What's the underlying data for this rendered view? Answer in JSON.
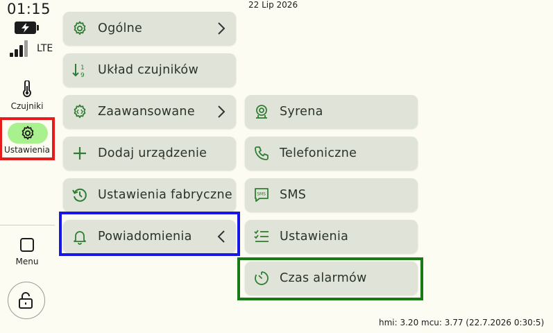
{
  "status": {
    "time": "01:15",
    "network": "LTE",
    "date": "22 Lip 2026",
    "version_info": "hmi: 3.20 mcu: 3.77 (22.7.2026 0:30:5)"
  },
  "sidebar": {
    "items": [
      {
        "label": "Czujniki",
        "icon": "thermometer-icon"
      },
      {
        "label": "Ustawienia",
        "icon": "gear-icon",
        "selected": true
      },
      {
        "label": "Menu",
        "icon": "square-icon"
      }
    ],
    "lock_icon": "unlock-icon"
  },
  "menu": {
    "main": [
      {
        "label": "Ogólne",
        "icon": "gear-icon",
        "chevron": "right"
      },
      {
        "label": "Układ czujników",
        "icon": "sort-icon"
      },
      {
        "label": "Zaawansowane",
        "icon": "gear-code-icon",
        "chevron": "right"
      },
      {
        "label": "Dodaj urządzenie",
        "icon": "plus-icon"
      },
      {
        "label": "Ustawienia fabryczne",
        "icon": "history-icon"
      },
      {
        "label": "Powiadomienia",
        "icon": "bell-icon",
        "chevron": "left"
      }
    ],
    "sub": [
      {
        "label": "Syrena",
        "icon": "siren-icon"
      },
      {
        "label": "Telefoniczne",
        "icon": "phone-icon"
      },
      {
        "label": "SMS",
        "icon": "sms-icon"
      },
      {
        "label": "Ustawienia",
        "icon": "checklist-icon"
      },
      {
        "label": "Czas alarmów",
        "icon": "timer-icon"
      }
    ]
  },
  "colors": {
    "background": "#fcfcf3",
    "button": "#dfe3d8",
    "icon": "#2e7d32",
    "selected_pill": "#a9f08f",
    "highlight_red": "#e81b1b",
    "highlight_blue": "#1717e6",
    "highlight_green": "#177a17"
  }
}
